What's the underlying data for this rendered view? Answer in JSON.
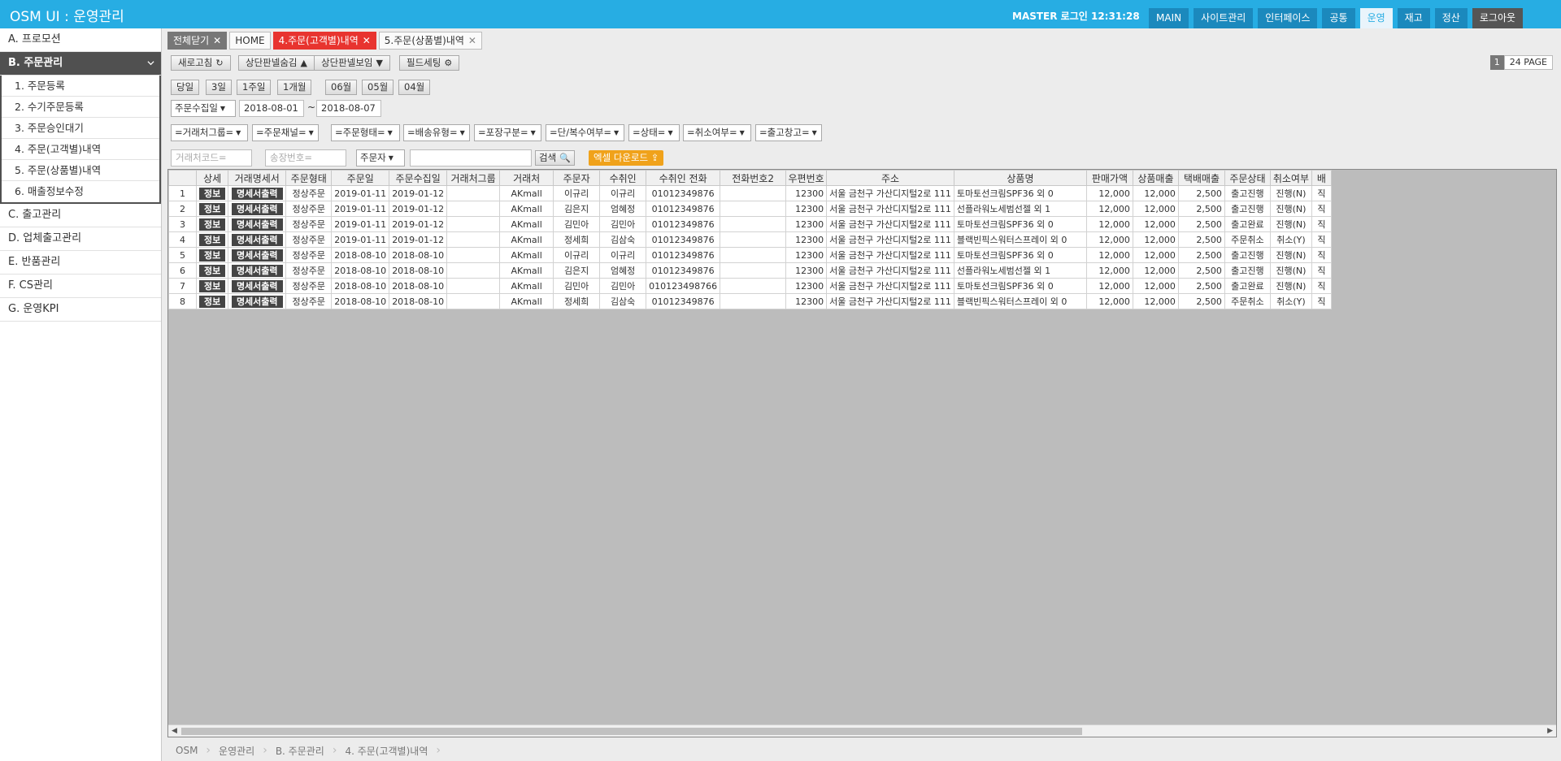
{
  "app": {
    "title": "OSM UI : 운영관리"
  },
  "header": {
    "login_info": "MASTER 로그인 12:31:28",
    "nav": [
      "MAIN",
      "사이트관리",
      "인터페이스",
      "공통",
      "운영",
      "재고",
      "정산",
      "로그아웃"
    ]
  },
  "sidebar": {
    "items": [
      "A. 프로모션",
      "B. 주문관리",
      "C. 출고관리",
      "D. 업체출고관리",
      "E. 반품관리",
      "F. CS관리",
      "G. 운영KPI"
    ],
    "sub_items": [
      "1. 주문등록",
      "2. 수기주문등록",
      "3. 주문승인대기",
      "4. 주문(고객별)내역",
      "5. 주문(상품별)내역",
      "6. 매출정보수정"
    ]
  },
  "tabs": [
    "전체닫기",
    "HOME",
    "4.주문(고객별)내역",
    "5.주문(상품별)내역"
  ],
  "toolbar": {
    "refresh": "새로고침",
    "hide_panel": "상단판넬숨김",
    "show_panel": "상단판넬보임",
    "field_setting": "필드세팅"
  },
  "pager": {
    "current": "1",
    "total": "24 PAGE"
  },
  "date_buttons": [
    "당일",
    "3일",
    "1주일",
    "1개월",
    "06월",
    "05월",
    "04월"
  ],
  "date_filter": {
    "type": "주문수집일",
    "from": "2018-08-01",
    "tilde": "~",
    "to": "2018-08-07"
  },
  "filters": [
    "=거래처그룹=",
    "=주문채널=",
    "=주문형태=",
    "=배송유형=",
    "=포장구분=",
    "=단/복수여부=",
    "=상태=",
    "=취소여부=",
    "=출고창고="
  ],
  "search": {
    "vendor_code_placeholder": "거래처코드=",
    "invoice_placeholder": "송장번호=",
    "field_select": "주문자",
    "keyword": "",
    "search_button": "검색",
    "excel_button": "엑셀 다운로드"
  },
  "grid": {
    "columns": [
      "",
      "상세",
      "거래명세서",
      "주문형태",
      "주문일",
      "주문수집일",
      "거래처그룹",
      "거래처",
      "주문자",
      "수취인",
      "수취인 전화",
      "전화번호2",
      "우편번호",
      "주소",
      "상품명",
      "판매가액",
      "상품매출",
      "택배매출",
      "주문상태",
      "취소여부",
      "배"
    ],
    "detail_btn": "정보",
    "invoice_btn": "명세서출력",
    "rows": [
      [
        "1",
        "정상주문",
        "2019-01-11",
        "2019-01-12",
        "",
        "AKmall",
        "이규리",
        "이규리",
        "01012349876",
        "",
        "12300",
        "서울 금천구 가산디지털2로 111",
        "토마토선크림SPF36 외 0",
        "12,000",
        "12,000",
        "2,500",
        "출고진행",
        "진행(N)",
        "직"
      ],
      [
        "2",
        "정상주문",
        "2019-01-11",
        "2019-01-12",
        "",
        "AKmall",
        "김은지",
        "엄혜정",
        "01012349876",
        "",
        "12300",
        "서울 금천구 가산디지털2로 111",
        "선플라워노세범선젤 외 1",
        "12,000",
        "12,000",
        "2,500",
        "출고진행",
        "진행(N)",
        "직"
      ],
      [
        "3",
        "정상주문",
        "2019-01-11",
        "2019-01-12",
        "",
        "AKmall",
        "김민아",
        "김민아",
        "01012349876",
        "",
        "12300",
        "서울 금천구 가산디지털2로 111",
        "토마토선크림SPF36 외 0",
        "12,000",
        "12,000",
        "2,500",
        "출고완료",
        "진행(N)",
        "직"
      ],
      [
        "4",
        "정상주문",
        "2019-01-11",
        "2019-01-12",
        "",
        "AKmall",
        "정세희",
        "김삼숙",
        "01012349876",
        "",
        "12300",
        "서울 금천구 가산디지털2로 111",
        "블랙빈픽스워터스프레이 외 0",
        "12,000",
        "12,000",
        "2,500",
        "주문취소",
        "취소(Y)",
        "직"
      ],
      [
        "5",
        "정상주문",
        "2018-08-10",
        "2018-08-10",
        "",
        "AKmall",
        "이규리",
        "이규리",
        "01012349876",
        "",
        "12300",
        "서울 금천구 가산디지털2로 111",
        "토마토선크림SPF36 외 0",
        "12,000",
        "12,000",
        "2,500",
        "출고진행",
        "진행(N)",
        "직"
      ],
      [
        "6",
        "정상주문",
        "2018-08-10",
        "2018-08-10",
        "",
        "AKmall",
        "김은지",
        "엄혜정",
        "01012349876",
        "",
        "12300",
        "서울 금천구 가산디지털2로 111",
        "선플라워노세범선젤 외 1",
        "12,000",
        "12,000",
        "2,500",
        "출고진행",
        "진행(N)",
        "직"
      ],
      [
        "7",
        "정상주문",
        "2018-08-10",
        "2018-08-10",
        "",
        "AKmall",
        "김민아",
        "김민아",
        "010123498766",
        "",
        "12300",
        "서울 금천구 가산디지털2로 111",
        "토마토선크림SPF36 외 0",
        "12,000",
        "12,000",
        "2,500",
        "출고완료",
        "진행(N)",
        "직"
      ],
      [
        "8",
        "정상주문",
        "2018-08-10",
        "2018-08-10",
        "",
        "AKmall",
        "정세희",
        "김삼숙",
        "01012349876",
        "",
        "12300",
        "서울 금천구 가산디지털2로 111",
        "블랙빈픽스워터스프레이 외 0",
        "12,000",
        "12,000",
        "2,500",
        "주문취소",
        "취소(Y)",
        "직"
      ]
    ]
  },
  "breadcrumb": [
    "OSM",
    "운영관리",
    "B. 주문관리",
    "4. 주문(고객별)내역"
  ]
}
